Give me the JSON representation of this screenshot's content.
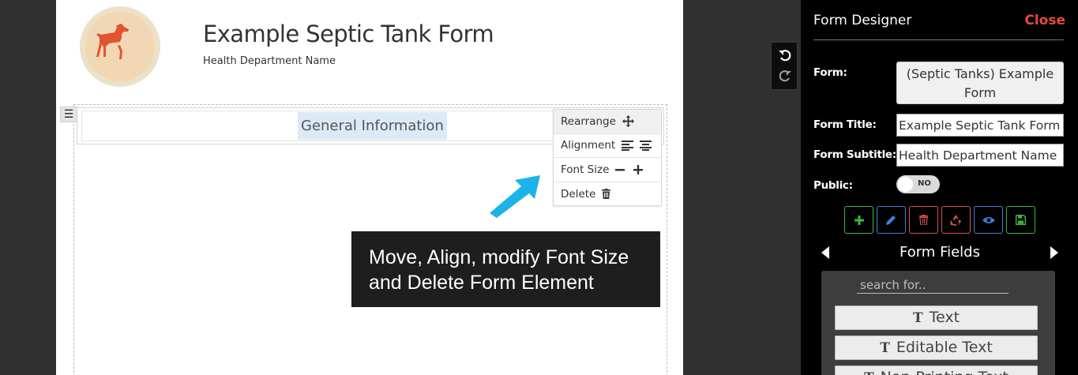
{
  "form_canvas": {
    "title": "Example Septic Tank Form",
    "subtitle": "Health Department Name",
    "logo_icon": "dog-icon",
    "section_heading": "General Information",
    "element_toolbar": {
      "rearrange_label": "Rearrange",
      "alignment_label": "Alignment",
      "font_size_label": "Font Size",
      "delete_label": "Delete"
    }
  },
  "annotation": {
    "line1": "Move, Align, modify Font Size",
    "line2": "and Delete Form Element",
    "arrow_color": "#1ab4e8"
  },
  "designer": {
    "title": "Form Designer",
    "close_label": "Close",
    "form_label": "Form:",
    "form_value_line1": "(Septic Tanks) Example",
    "form_value_line2": "Form",
    "form_title_label": "Form Title:",
    "form_title_value": "Example Septic Tank Form",
    "form_subtitle_label": "Form Subtitle:",
    "form_subtitle_value": "Health Department Name",
    "public_label": "Public:",
    "public_toggle_text": "NO",
    "actions": [
      {
        "name": "add",
        "icon": "plus-icon",
        "color": "#3db83d"
      },
      {
        "name": "edit",
        "icon": "pencil-icon",
        "color": "#3f7fd6"
      },
      {
        "name": "delete",
        "icon": "trash-icon",
        "color": "#d9534f"
      },
      {
        "name": "recycle",
        "icon": "recycle-icon",
        "color": "#d9534f"
      },
      {
        "name": "preview",
        "icon": "eye-icon",
        "color": "#3f7fd6"
      },
      {
        "name": "save",
        "icon": "floppy-icon",
        "color": "#3db83d"
      }
    ],
    "fields_title": "Form Fields",
    "search_placeholder": "search for..",
    "field_buttons": [
      "Text",
      "Editable Text",
      "Non-Printing Text"
    ]
  },
  "colors": {
    "accent_red": "#e64a3c",
    "heading_highlight": "#dceaf6",
    "logo_dog": "#e0552f"
  }
}
